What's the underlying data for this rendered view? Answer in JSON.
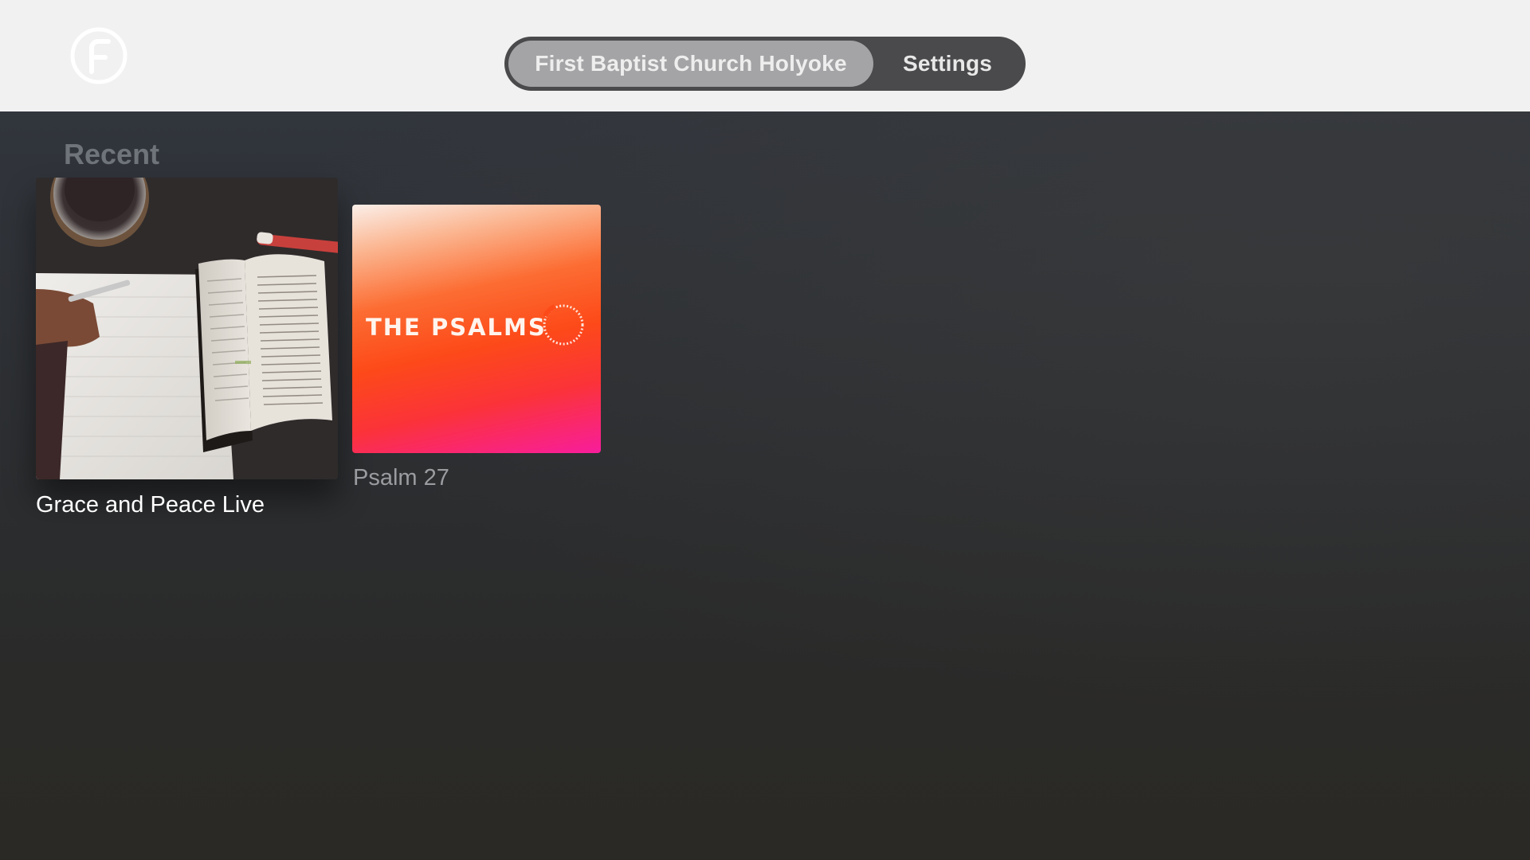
{
  "header": {
    "logo_icon": "f-circle-logo-icon",
    "tabs": [
      {
        "label": "First Baptist Church Holyoke",
        "selected": true
      },
      {
        "label": "Settings",
        "selected": false
      }
    ]
  },
  "recent": {
    "title": "Recent",
    "items": [
      {
        "title": "Grace and Peace Live",
        "focused": true,
        "artwork": "bible-notebook-photo"
      },
      {
        "title": "Psalm 27",
        "focused": false,
        "artwork": "the-psalms-artwork",
        "artwork_text": "THE PSALMS"
      }
    ]
  },
  "colors": {
    "topbar": "#f1f1f1",
    "tab_bar": "#4a4a4c",
    "tab_selected": "#a4a4a6",
    "psalms_orange": "#fd4a19",
    "psalms_pink": "#f81d9c"
  }
}
